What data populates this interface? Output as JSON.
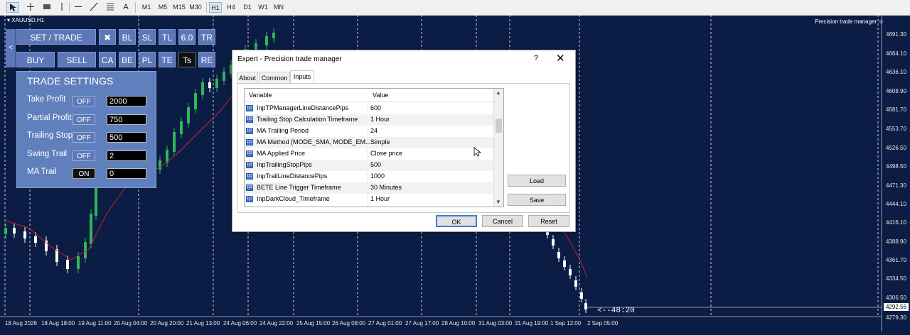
{
  "toolbar": {
    "tools": [
      "cursor-icon",
      "crosshair-icon",
      "zoom-icon",
      "vertical-line-icon",
      "horizontal-line-icon",
      "trendline-icon",
      "fibonacci-icon",
      "text-icon"
    ],
    "text_tool": "A",
    "timeframes": [
      "M1",
      "M5",
      "M15",
      "M30",
      "H1",
      "H4",
      "D1",
      "W1",
      "MN"
    ],
    "active_timeframe": "H1"
  },
  "chart": {
    "symbol": "XAUUSD,H1",
    "ea_name": "Precision  trade manager",
    "price_labels": [
      "4691.30",
      "4664.10",
      "4636.10",
      "4608.90",
      "4581.70",
      "4553.70",
      "4526.50",
      "4498.50",
      "4471.30",
      "4444.10",
      "4416.10",
      "4388.90",
      "4361.70",
      "4334.50",
      "4306.50",
      "4292.56",
      "4279.30"
    ],
    "current_price": "4292.56",
    "date_labels": [
      "18 Aug 2026",
      "18 Aug 18:00",
      "19 Aug 11:00",
      "20 Aug 04:00",
      "20 Aug 20:00",
      "21 Aug 13:00",
      "24 Aug 06:00",
      "24 Aug 22:00",
      "25 Aug 15:00",
      "26 Aug 08:00",
      "27 Aug 01:00",
      "27 Aug 17:00",
      "28 Aug 10:00",
      "31 Aug 03:00",
      "31 Aug 19:00",
      "1 Sep 12:00",
      "2 Sep 05:00"
    ],
    "bar_timer": "<--48:20",
    "colors": {
      "background": "#0b1d44",
      "bull": "#2fb55a",
      "bear": "#ffffff",
      "ma": "#c0242c"
    }
  },
  "trade_panel": {
    "collapse_label": "<",
    "row1": [
      "SET / TRADE",
      "✖",
      "BL",
      "SL",
      "TL",
      "6.0",
      "TR"
    ],
    "row2": [
      "BUY",
      "SELL",
      "CA",
      "BE",
      "PL",
      "TE",
      "Ts",
      "RE"
    ],
    "settings_title": "TRADE SETTINGS",
    "settings": [
      {
        "label": "Take Profit",
        "state": "OFF",
        "value": "2000"
      },
      {
        "label": "Partial Profit",
        "state": "OFF",
        "value": "750"
      },
      {
        "label": "Trailing Stop",
        "state": "OFF",
        "value": "500"
      },
      {
        "label": "Swing Trail",
        "state": "OFF",
        "value": "2"
      },
      {
        "label": "MA Trail",
        "state": "ON",
        "value": "0"
      }
    ]
  },
  "dialog": {
    "title": "Expert - Precision  trade manager",
    "help": "?",
    "close": "✕",
    "tabs": [
      "About",
      "Common",
      "Inputs"
    ],
    "active_tab": "Inputs",
    "columns": [
      "Variable",
      "Value"
    ],
    "rows": [
      {
        "name": "InpTPManagerLineDistancePips",
        "value": "600"
      },
      {
        "name": "Trailing Stop Calculation Timeframe",
        "value": "1 Hour"
      },
      {
        "name": "MA Trailing Period",
        "value": "24"
      },
      {
        "name": "MA Method (MODE_SMA, MODE_EM...",
        "value": "Simple"
      },
      {
        "name": "MA Applied Price",
        "value": "Close price"
      },
      {
        "name": "InpTrailingStopPips",
        "value": "500"
      },
      {
        "name": "InpTrailLineDistancePips",
        "value": "1000"
      },
      {
        "name": "BETE Line Trigger Timeframe",
        "value": "30 Minutes"
      },
      {
        "name": "InpDarkCloud_Timeframe",
        "value": "1 Hour"
      }
    ],
    "row_icon": "123",
    "load": "Load",
    "save": "Save",
    "ok": "OK",
    "cancel": "Cancel",
    "reset": "Reset"
  }
}
